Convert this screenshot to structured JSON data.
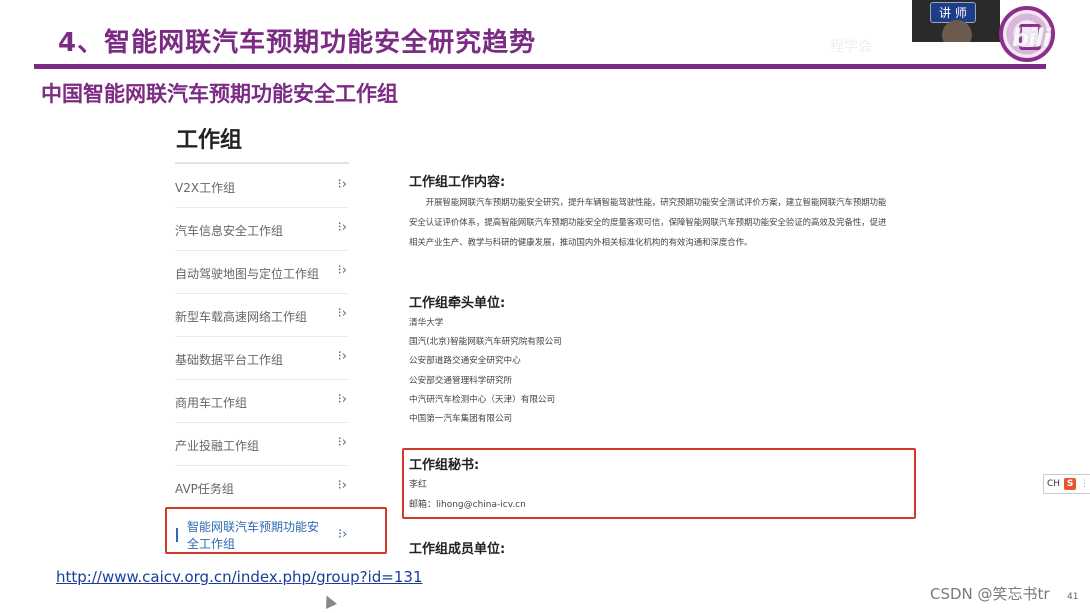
{
  "slide": {
    "title": "4、智能网联汽车预期功能安全研究趋势",
    "subtitle": "中国智能网联汽车预期功能安全工作组",
    "faint_text": "程学会"
  },
  "overlay": {
    "lecturer_badge": "讲 师",
    "page_number": "41",
    "watermark": "CSDN @笑忘书tr",
    "ime_label": "CH",
    "ime_icon": "S"
  },
  "menu": {
    "heading": "工作组",
    "items": [
      {
        "label": "V2X工作组"
      },
      {
        "label": "汽车信息安全工作组"
      },
      {
        "label": "自动驾驶地图与定位工作组"
      },
      {
        "label": "新型车载高速网络工作组"
      },
      {
        "label": "基础数据平台工作组"
      },
      {
        "label": "商用车工作组"
      },
      {
        "label": "产业投融工作组"
      },
      {
        "label": "AVP任务组"
      }
    ],
    "active_item": "智能网联汽车预期功能安全工作组",
    "arrow_icon": "chevron-right-icon"
  },
  "content": {
    "work_title": "工作组工作内容:",
    "work_text": "开展智能网联汽车预期功能安全研究，提升车辆智能驾驶性能，研究预期功能安全测试评价方案，建立智能网联汽车预期功能安全认证评价体系，提高智能网联汽车预期功能安全的度量客观可信，保障智能网联汽车预期功能安全验证的高效及完备性，促进相关产业生产、教学与科研的健康发展，推动国内外相关标准化机构的有效沟通和深度合作。",
    "lead_title": "工作组牵头单位:",
    "lead_orgs": [
      "清华大学",
      "国汽(北京)智能网联汽车研究院有限公司",
      "公安部道路交通安全研究中心",
      "公安部交通管理科学研究所",
      "中汽研汽车检测中心（天津）有限公司",
      "中国第一汽车集团有限公司"
    ],
    "secretary_title": "工作组秘书:",
    "secretary_name": "李红",
    "secretary_email": "邮箱：lihong@china-icv.cn",
    "members_title": "工作组成员单位:"
  },
  "link": {
    "url": "http://www.caicv.org.cn/index.php/group?id=131"
  }
}
